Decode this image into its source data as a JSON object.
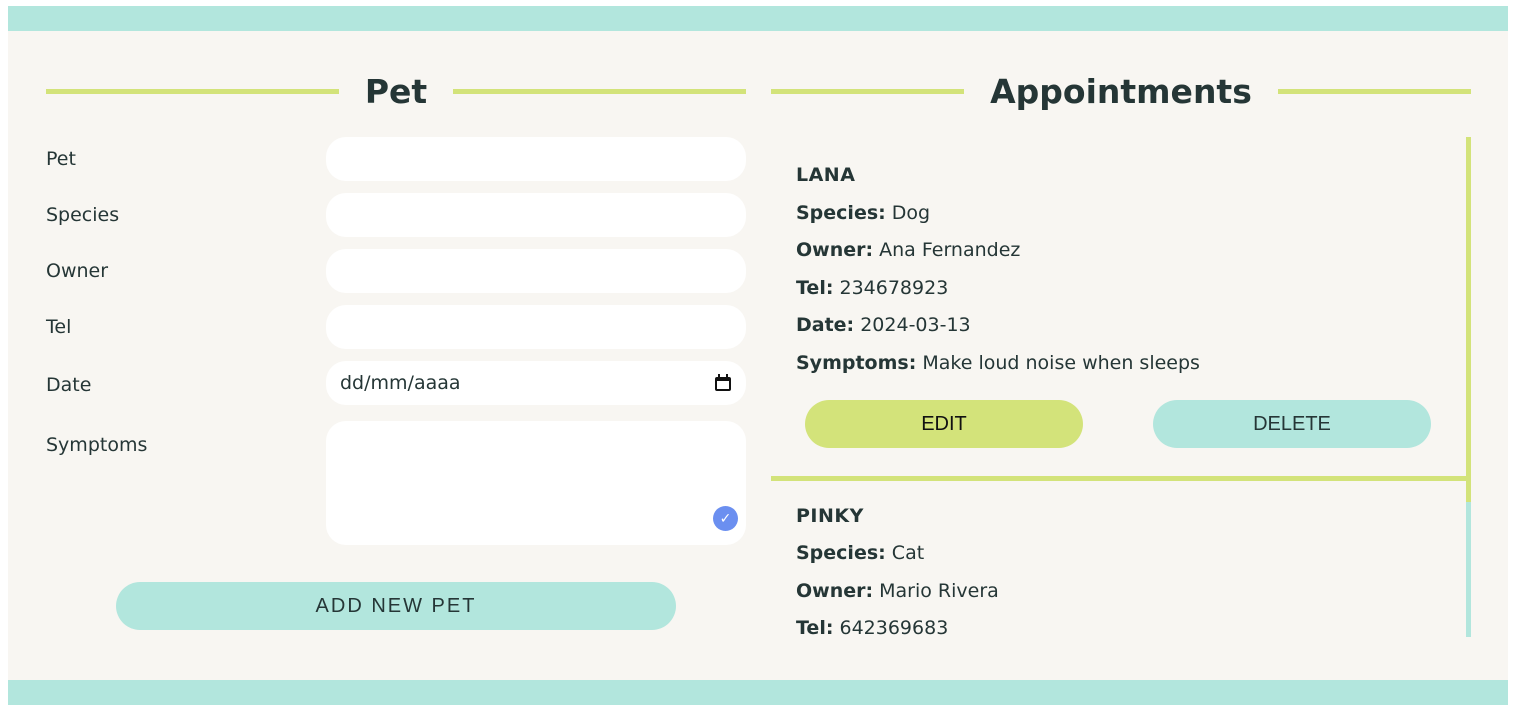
{
  "form": {
    "title": "Pet",
    "fields": {
      "pet": {
        "label": "Pet",
        "value": ""
      },
      "species": {
        "label": "Species",
        "value": ""
      },
      "owner": {
        "label": "Owner",
        "value": ""
      },
      "tel": {
        "label": "Tel",
        "value": ""
      },
      "date": {
        "label": "Date",
        "value": "dd/mm/aaaa"
      },
      "symptoms": {
        "label": "Symptoms",
        "value": ""
      }
    },
    "submit_label": "ADD NEW PET"
  },
  "appointments": {
    "title": "Appointments",
    "labels": {
      "species": "Species:",
      "owner": "Owner:",
      "tel": "Tel:",
      "date": "Date:",
      "symptoms": "Symptoms:"
    },
    "items": [
      {
        "name": "LANA",
        "species": "Dog",
        "owner": "Ana Fernandez",
        "tel": "234678923",
        "date": "2024-03-13",
        "symptoms": "Make loud noise when sleeps",
        "edit_label": "EDIT",
        "delete_label": "DELETE"
      },
      {
        "name": "PINKY",
        "species": "Cat",
        "owner": "Mario Rivera",
        "tel": "642369683"
      }
    ]
  },
  "colors": {
    "mint": "#b2e6dd",
    "lime": "#d3e37a",
    "background": "#f8f6f2",
    "text": "#253636",
    "check": "#6b8ff0"
  },
  "icons": {
    "date": "calendar-icon",
    "symptoms": "check-circle-icon"
  }
}
